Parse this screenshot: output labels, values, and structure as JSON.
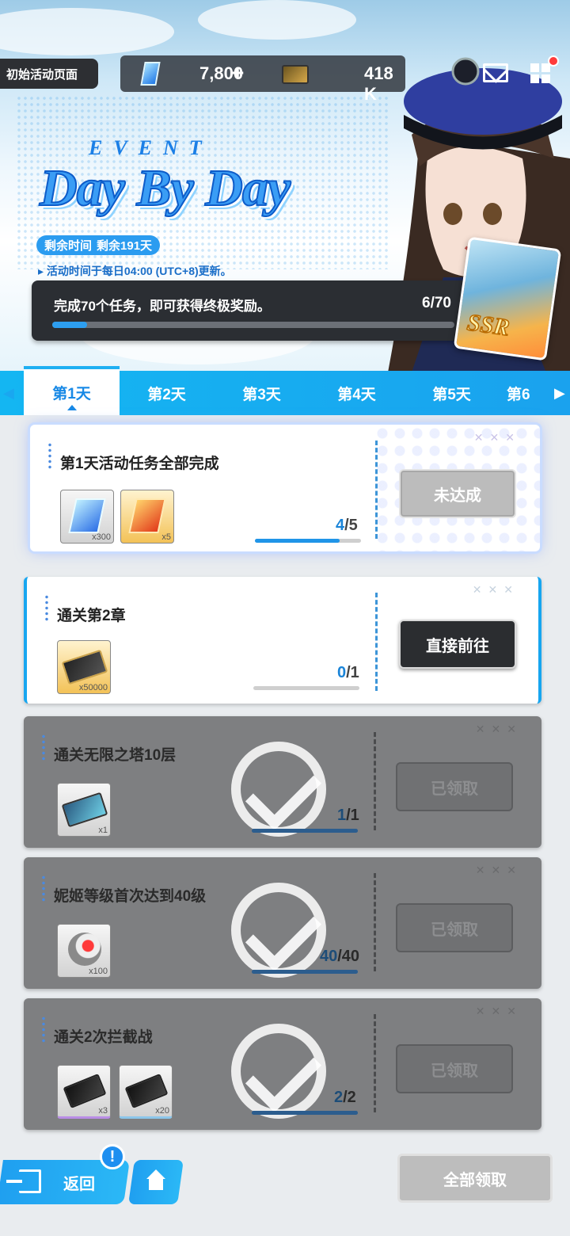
{
  "header": {
    "page_label": "初始活动页面",
    "gems": "7,800",
    "plus": "+",
    "credits": "418 K"
  },
  "event": {
    "event_word": "EVENT",
    "title": "Day By Day",
    "remaining_label": "剩余时间",
    "remaining_value": "剩余191天",
    "refresh_note": "▸ 活动时间于每日04:00 (UTC+8)更新。",
    "mission_text": "完成70个任务，即可获得终极奖励。",
    "mission_count": "6/70",
    "mission_progress": 0.0857,
    "ssr_label": "SSR"
  },
  "tabs": [
    "第1天",
    "第2天",
    "第3天",
    "第4天",
    "第5天",
    "第6"
  ],
  "tasks": [
    {
      "title": "第1天活动任务全部完成",
      "rewards": [
        {
          "icon": "blue-gem-icon",
          "qty": "x300"
        },
        {
          "icon": "gold-gem-icon",
          "qty": "x5"
        }
      ],
      "current": "4",
      "total": "/5",
      "progress": 0.8,
      "button": "未达成"
    },
    {
      "title": "通关第2章",
      "rewards": [
        {
          "icon": "credit-card-icon",
          "qty": "x50000"
        }
      ],
      "current": "0",
      "total": "/1",
      "progress": 0,
      "button": "直接前往"
    },
    {
      "title": "通关无限之塔10层",
      "rewards": [
        {
          "icon": "tower-card-icon",
          "qty": "x1"
        }
      ],
      "current": "1",
      "total": "/1",
      "progress": 1,
      "button": "已领取"
    },
    {
      "title": "妮姬等级首次达到40级",
      "rewards": [
        {
          "icon": "core-ball-icon",
          "qty": "x100"
        }
      ],
      "current": "40",
      "total": "/40",
      "progress": 1,
      "button": "已领取"
    },
    {
      "title": "通关2次拦截战",
      "rewards": [
        {
          "icon": "chip-icon",
          "qty": "x3"
        },
        {
          "icon": "chip-icon",
          "qty": "x20"
        }
      ],
      "current": "2",
      "total": "/2",
      "progress": 1,
      "button": "已领取"
    }
  ],
  "footer": {
    "back_label": "返回",
    "alert": "!",
    "claim_all_label": "全部领取"
  },
  "colors": {
    "accent": "#1aa2ee",
    "panel_dark": "#2b2e33",
    "completed_card": "#7e7f81"
  }
}
